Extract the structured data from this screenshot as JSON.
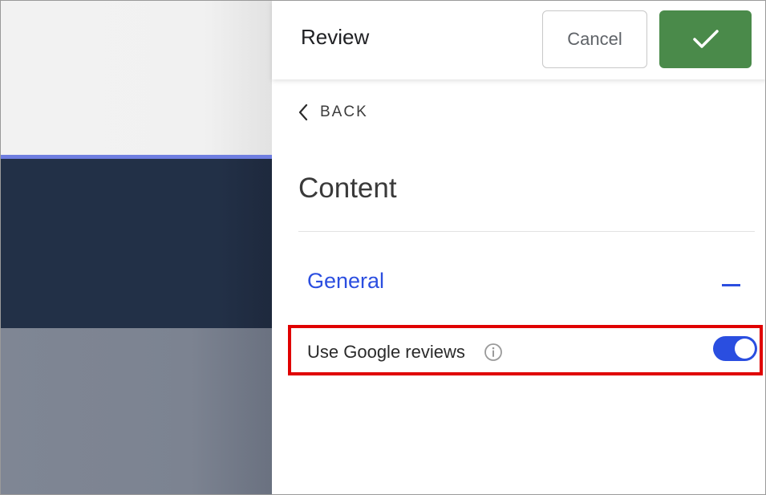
{
  "preview": {
    "colors": {
      "top": "#f2f2f2",
      "accent_line": "#6f7ee0",
      "dark_band": "#223047",
      "gray_band": "#7f8694"
    }
  },
  "header": {
    "title": "Review",
    "cancel_label": "Cancel",
    "confirm_icon": "check-icon"
  },
  "nav": {
    "back_label": "BACK",
    "back_icon": "chevron-left-icon"
  },
  "content": {
    "title": "Content"
  },
  "section": {
    "title": "General",
    "collapse_icon": "minus-icon",
    "accent_color": "#2b4ee0"
  },
  "setting": {
    "label": "Use Google reviews",
    "info_icon": "info-icon",
    "enabled": true,
    "toggle_color": "#2a4ee0"
  },
  "highlight_color": "#e00000",
  "confirm_button_color": "#4a8a4a"
}
